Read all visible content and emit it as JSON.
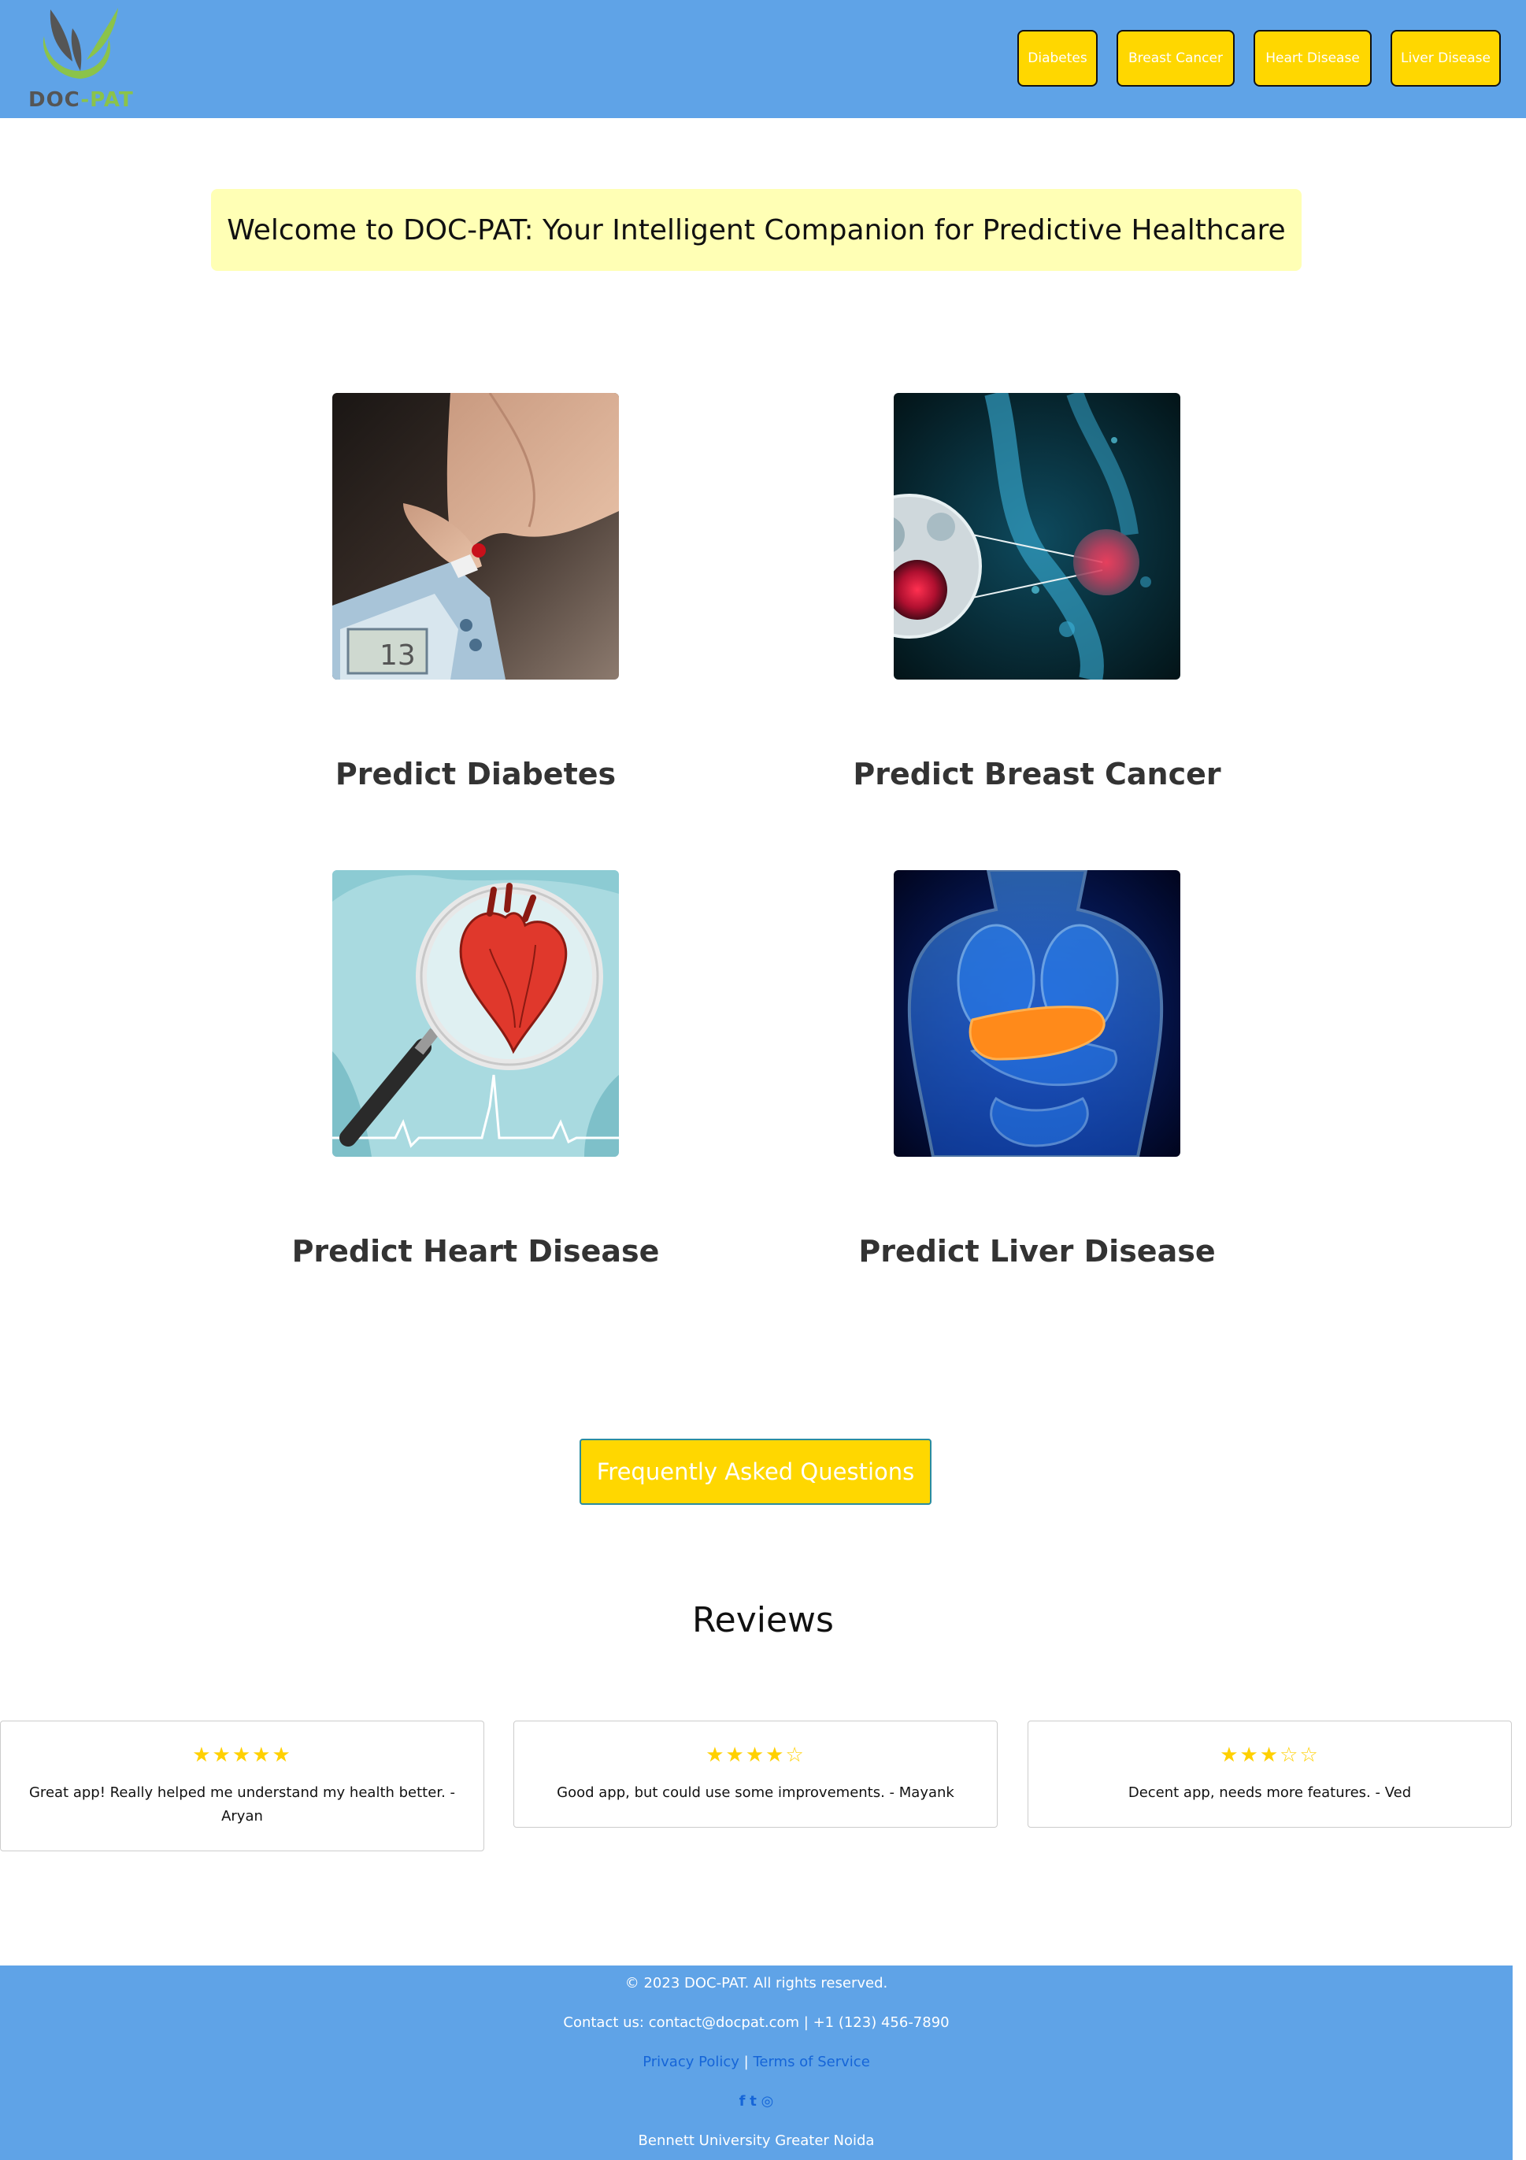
{
  "header": {
    "logo": {
      "text_doc": "DOC",
      "text_dash": "-",
      "text_pat": "PAT"
    },
    "nav": [
      {
        "label": "Diabetes"
      },
      {
        "label": "Breast Cancer"
      },
      {
        "label": "Heart Disease"
      },
      {
        "label": "Liver Disease"
      }
    ]
  },
  "welcome": {
    "text": "Welcome to DOC-PAT: Your Intelligent Companion for Predictive Healthcare"
  },
  "cards": [
    {
      "title": "Predict Diabetes",
      "image": "glucose-meter-finger"
    },
    {
      "title": "Predict Breast Cancer",
      "image": "breast-cancer-cell"
    },
    {
      "title": "Predict Heart Disease",
      "image": "heart-magnifier"
    },
    {
      "title": "Predict Liver Disease",
      "image": "liver-anatomy"
    }
  ],
  "faq": {
    "label": "Frequently Asked Questions"
  },
  "reviews": {
    "title": "Reviews",
    "items": [
      {
        "stars": "★★★★★",
        "text": "Great app! Really helped me understand my health better. - Aryan"
      },
      {
        "stars": "★★★★☆",
        "text": "Good app, but could use some improvements. - Mayank"
      },
      {
        "stars": "★★★☆☆",
        "text": "Decent app, needs more features. - Ved"
      }
    ]
  },
  "footer": {
    "copyright": "© 2023 DOC-PAT. All rights reserved.",
    "contact": "Contact us: contact@docpat.com | +1 (123) 456-7890",
    "privacy": "Privacy Policy",
    "separator": "|",
    "terms": "Terms of Service",
    "social_icons": [
      "facebook-icon",
      "twitter-icon",
      "instagram-icon"
    ],
    "social_glyphs": {
      "facebook": "f",
      "twitter": "t",
      "instagram": "◎"
    },
    "location": "Bennett University Greater Noida"
  },
  "colors": {
    "header_bg": "#5fa3e7",
    "nav_button": "#ffd700",
    "welcome_bg": "#ffffb5",
    "star": "#ffd000",
    "link": "#1565d8"
  }
}
